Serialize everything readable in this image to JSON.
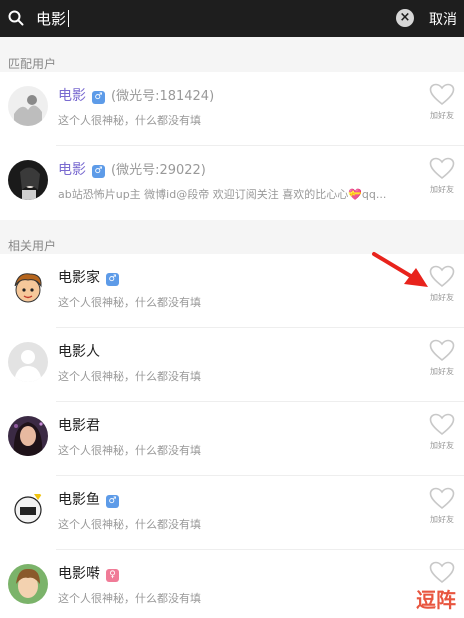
{
  "search": {
    "query": "电影",
    "cancel": "取消"
  },
  "sections": {
    "matched": "匹配用户",
    "related": "相关用户"
  },
  "follow_label": "加好友",
  "colors": {
    "topbar": "#1e1e1e",
    "accent_name": "#7a6bd0",
    "male_badge": "#5d9be8",
    "female_badge": "#f07b97",
    "arrow": "#e8231c"
  },
  "gender_icons": {
    "male": "♂",
    "female": "♀"
  },
  "matched_users": [
    {
      "name": "电影",
      "gender": "male",
      "wxid": "(微光号:181424)",
      "bio": "这个人很神秘，什么都没有填"
    },
    {
      "name": "电影",
      "gender": "male",
      "wxid": "(微光号:29022)",
      "bio": "ab站恐怖片up主  微博id@段帝 欢迎订阅关注  喜欢的比心心💝qq..."
    }
  ],
  "related_users": [
    {
      "name": "电影家",
      "gender": "male",
      "bio": "这个人很神秘，什么都没有填"
    },
    {
      "name": "电影人",
      "bio": "这个人很神秘，什么都没有填"
    },
    {
      "name": "电影君",
      "bio": "这个人很神秘，什么都没有填"
    },
    {
      "name": "电影鱼",
      "gender": "male",
      "bio": "这个人很神秘，什么都没有填"
    },
    {
      "name": "电影啭",
      "gender": "female",
      "bio": "这个人很神秘，什么都没有填"
    }
  ],
  "watermark": "逗阵"
}
